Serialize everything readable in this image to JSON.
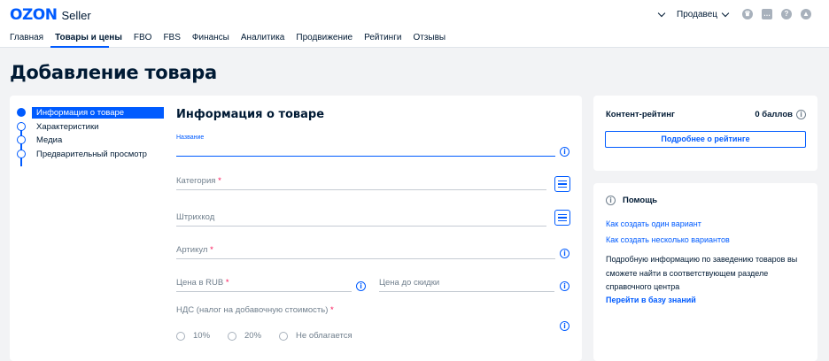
{
  "header": {
    "logo": "OZON",
    "logo_suffix": "Seller",
    "role": "Продавец",
    "nav": [
      "Главная",
      "Товары и цены",
      "FBO",
      "FBS",
      "Финансы",
      "Аналитика",
      "Продвижение",
      "Рейтинги",
      "Отзывы"
    ],
    "active_nav": "Товары и цены",
    "icons": [
      "chevron-down-icon",
      "crown-icon",
      "chat-icon",
      "help-icon",
      "graduation-cap-icon"
    ]
  },
  "page": {
    "title": "Добавление товара"
  },
  "steps": [
    {
      "label": "Информация о товаре",
      "active": true
    },
    {
      "label": "Характеристики",
      "active": false
    },
    {
      "label": "Медиа",
      "active": false
    },
    {
      "label": "Предварительный просмотр",
      "active": false
    }
  ],
  "form": {
    "title": "Информация о товаре",
    "name_label": "Название",
    "category_label": "Категория",
    "barcode_label": "Штрихкод",
    "article_label": "Артикул",
    "price_label": "Цена в RUB",
    "old_price_label": "Цена до скидки",
    "nds_label": "НДС (налог на добавочную стоимость)",
    "required_mark": "*",
    "nds_options": [
      "10%",
      "20%",
      "Не облагается"
    ]
  },
  "rating": {
    "title": "Контент-рейтинг",
    "score": "0 баллов",
    "button": "Подробнее о рейтинге"
  },
  "help": {
    "title": "Помощь",
    "link_one": "Как создать один вариант",
    "link_many": "Как создать несколько вариантов",
    "text": "Подробную информацию по заведению товаров вы сможете найти в соответствующем разделе справочного центра",
    "kb_link": "Перейти в базу знаний"
  },
  "colors": {
    "accent": "#005bff",
    "required": "#f91155",
    "background": "#f2f3f5"
  }
}
